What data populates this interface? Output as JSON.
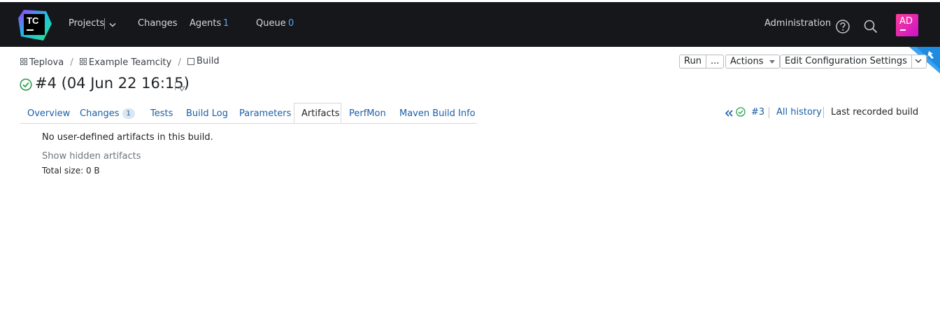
{
  "header": {
    "logo_text": "TC",
    "nav": {
      "projects": "Projects",
      "changes": "Changes",
      "agents": "Agents",
      "agents_count": "1",
      "queue": "Queue",
      "queue_count": "0"
    },
    "administration": "Administration",
    "avatar_initials": "AD",
    "icons": [
      "help-icon",
      "search-icon",
      "chevron-down-icon"
    ]
  },
  "breadcrumb": {
    "items": [
      "Teplova",
      "Example Teamcity",
      "Build"
    ],
    "separator": "/"
  },
  "build": {
    "title": "#4 (04 Jun 22 16:15)",
    "status": "success"
  },
  "toolbar": {
    "run_label": "Run",
    "run_more_label": "...",
    "actions_label": "Actions",
    "edit_label": "Edit Configuration Settings"
  },
  "tabs": [
    {
      "label": "Overview"
    },
    {
      "label": "Changes",
      "badge": "1"
    },
    {
      "label": "Tests"
    },
    {
      "label": "Build Log"
    },
    {
      "label": "Parameters"
    },
    {
      "label": "Artifacts",
      "active": true
    },
    {
      "label": "PerfMon"
    },
    {
      "label": "Maven Build Info"
    }
  ],
  "history": {
    "prev_build": "#3",
    "all_history": "All history",
    "last_recorded": "Last recorded build"
  },
  "artifacts": {
    "message": "No user-defined artifacts in this build.",
    "show_hidden": "Show hidden artifacts",
    "total_size": "Total size: 0 B"
  },
  "colors": {
    "header_bg": "#16171a",
    "link": "#1a5fa6",
    "count": "#55a8f0",
    "success": "#2e9e4f",
    "avatar": "#e0239c",
    "ribbon": "#1e8be0"
  }
}
